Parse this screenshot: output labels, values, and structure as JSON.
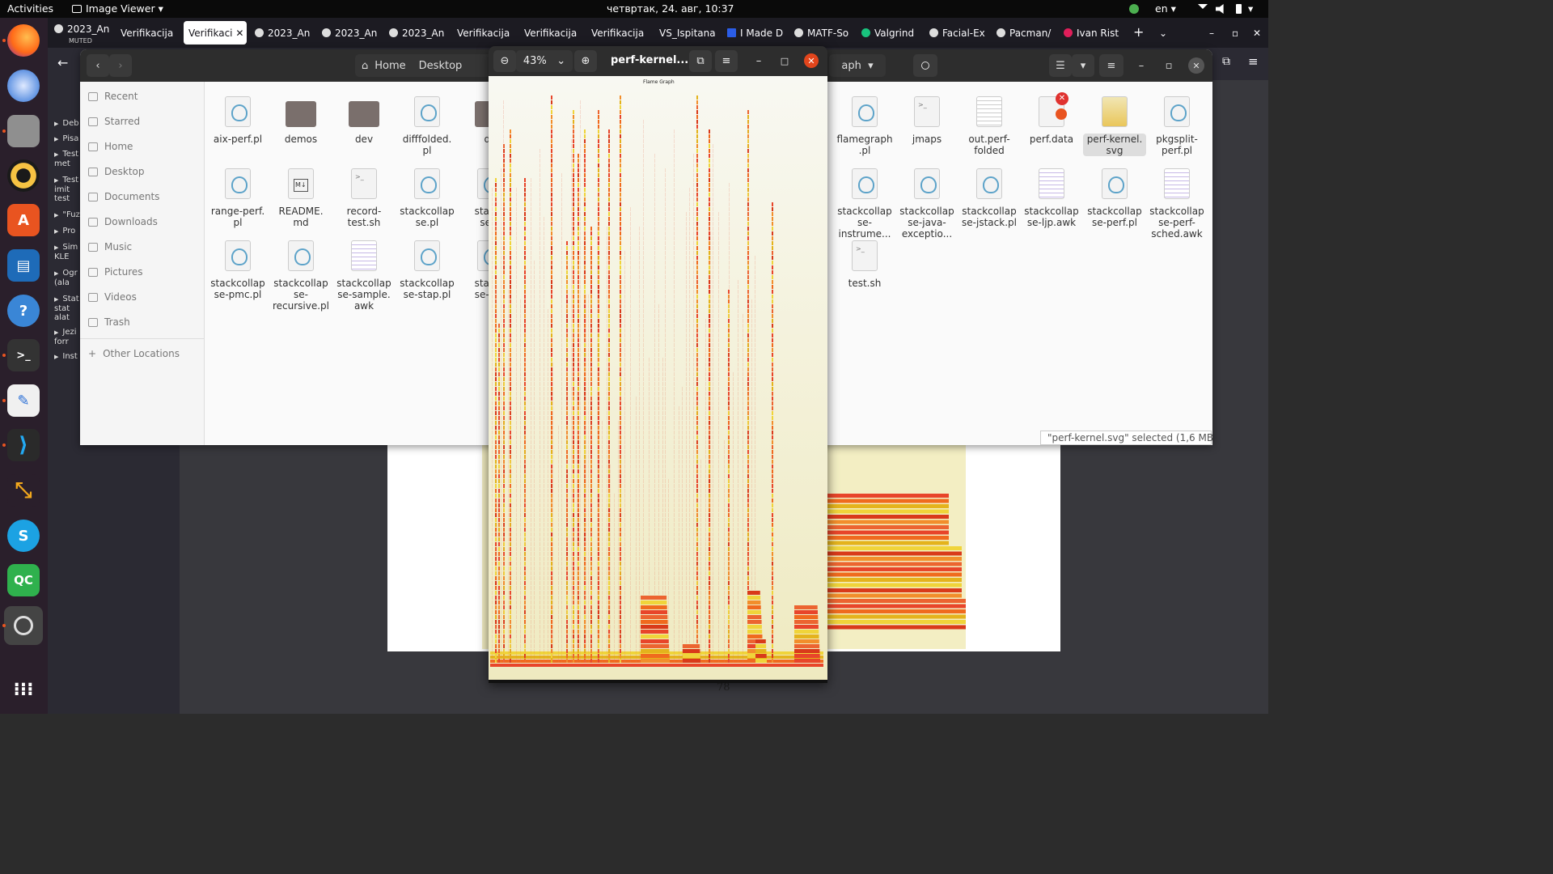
{
  "topbar": {
    "activities": "Activities",
    "app_menu": "Image Viewer",
    "clock": "четвртак, 24. авг, 10:37",
    "lang": "en"
  },
  "browser": {
    "tabs": [
      {
        "label": "2023_An",
        "sub": "MUTED",
        "active": false
      },
      {
        "label": "Verifikacija",
        "active": false
      },
      {
        "label": "Verifikaci",
        "active": true
      },
      {
        "label": "2023_An",
        "active": false
      },
      {
        "label": "2023_An",
        "active": false
      },
      {
        "label": "2023_An",
        "active": false
      },
      {
        "label": "Verifikacija",
        "active": false
      },
      {
        "label": "Verifikacija",
        "active": false
      },
      {
        "label": "Verifikacija",
        "active": false
      },
      {
        "label": "VS_Ispitana",
        "active": false
      },
      {
        "label": "I Made D",
        "active": false
      },
      {
        "label": "MATF-So",
        "active": false
      },
      {
        "label": "Valgrind",
        "active": false
      },
      {
        "label": "Facial-Ex",
        "active": false
      },
      {
        "label": "Pacman/",
        "active": false
      },
      {
        "label": "Ivan Rist",
        "active": false
      }
    ],
    "pdf_outline": [
      "Deb",
      "Pisa",
      "Test met",
      "Test imit test",
      "\"Fuz",
      "Pro",
      "Sim KLE",
      "Ogr (ala",
      "Stat stat alat",
      "Jezi forr",
      "Inst"
    ],
    "page_number": "78"
  },
  "files": {
    "path": [
      "Home",
      "Desktop"
    ],
    "path_right": "aph",
    "sidebar": [
      {
        "label": "Recent",
        "icon": "clock-icon"
      },
      {
        "label": "Starred",
        "icon": "star-icon"
      },
      {
        "label": "Home",
        "icon": "home-icon"
      },
      {
        "label": "Desktop",
        "icon": "desktop-icon"
      },
      {
        "label": "Documents",
        "icon": "documents-icon"
      },
      {
        "label": "Downloads",
        "icon": "downloads-icon"
      },
      {
        "label": "Music",
        "icon": "music-icon"
      },
      {
        "label": "Pictures",
        "icon": "pictures-icon"
      },
      {
        "label": "Videos",
        "icon": "videos-icon"
      },
      {
        "label": "Trash",
        "icon": "trash-icon"
      }
    ],
    "other_locations": "Other Locations",
    "items_left": [
      {
        "name": "aix-perf.pl",
        "kind": "perl"
      },
      {
        "name": "demos",
        "kind": "folder"
      },
      {
        "name": "dev",
        "kind": "folder"
      },
      {
        "name": "difffolded.\npl",
        "kind": "perl"
      },
      {
        "name": "do",
        "kind": "folder"
      },
      {
        "name": "range-perf.\npl",
        "kind": "perl"
      },
      {
        "name": "README.\nmd",
        "kind": "md"
      },
      {
        "name": "record-\ntest.sh",
        "kind": "script"
      },
      {
        "name": "stackcollap\nse.pl",
        "kind": "perl"
      },
      {
        "name": "stacke\nse-a",
        "kind": "perl"
      },
      {
        "name": "stackcollap\nse-pmc.pl",
        "kind": "perl"
      },
      {
        "name": "stackcollap\nse-\nrecursive.pl",
        "kind": "perl"
      },
      {
        "name": "stackcollap\nse-sample.\nawk",
        "kind": "text"
      },
      {
        "name": "stackcollap\nse-stap.pl",
        "kind": "perl"
      },
      {
        "name": "stacke\nse-vsp",
        "kind": "perl"
      }
    ],
    "items_right": [
      {
        "name": "flamegraph\n.pl",
        "kind": "perl"
      },
      {
        "name": "jmaps",
        "kind": "script"
      },
      {
        "name": "out.perf-\nfolded",
        "kind": "doc"
      },
      {
        "name": "perf.data",
        "kind": "locked"
      },
      {
        "name": "perf-kernel.\nsvg",
        "kind": "svg",
        "selected": true
      },
      {
        "name": "pkgsplit-\nperf.pl",
        "kind": "perl"
      },
      {
        "name": "stackcollap\nse-\ninstrume...",
        "kind": "perl"
      },
      {
        "name": "stackcollap\nse-java-\nexceptio...",
        "kind": "perl"
      },
      {
        "name": "stackcollap\nse-jstack.pl",
        "kind": "perl"
      },
      {
        "name": "stackcollap\nse-ljp.awk",
        "kind": "text"
      },
      {
        "name": "stackcollap\nse-perf.pl",
        "kind": "perl"
      },
      {
        "name": "stackcollap\nse-perf-\nsched.awk",
        "kind": "text"
      },
      {
        "name": "test.sh",
        "kind": "script"
      }
    ],
    "status": "\"perf-kernel.svg\" selected  (1,6 MB)"
  },
  "viewer": {
    "zoom": "43%",
    "title": "perf-kernel...",
    "svg_title": "Flame Graph"
  },
  "colors": {
    "accent": "#e95420",
    "flame_bg": "#f3eec3",
    "close_red": "#e2451c"
  }
}
